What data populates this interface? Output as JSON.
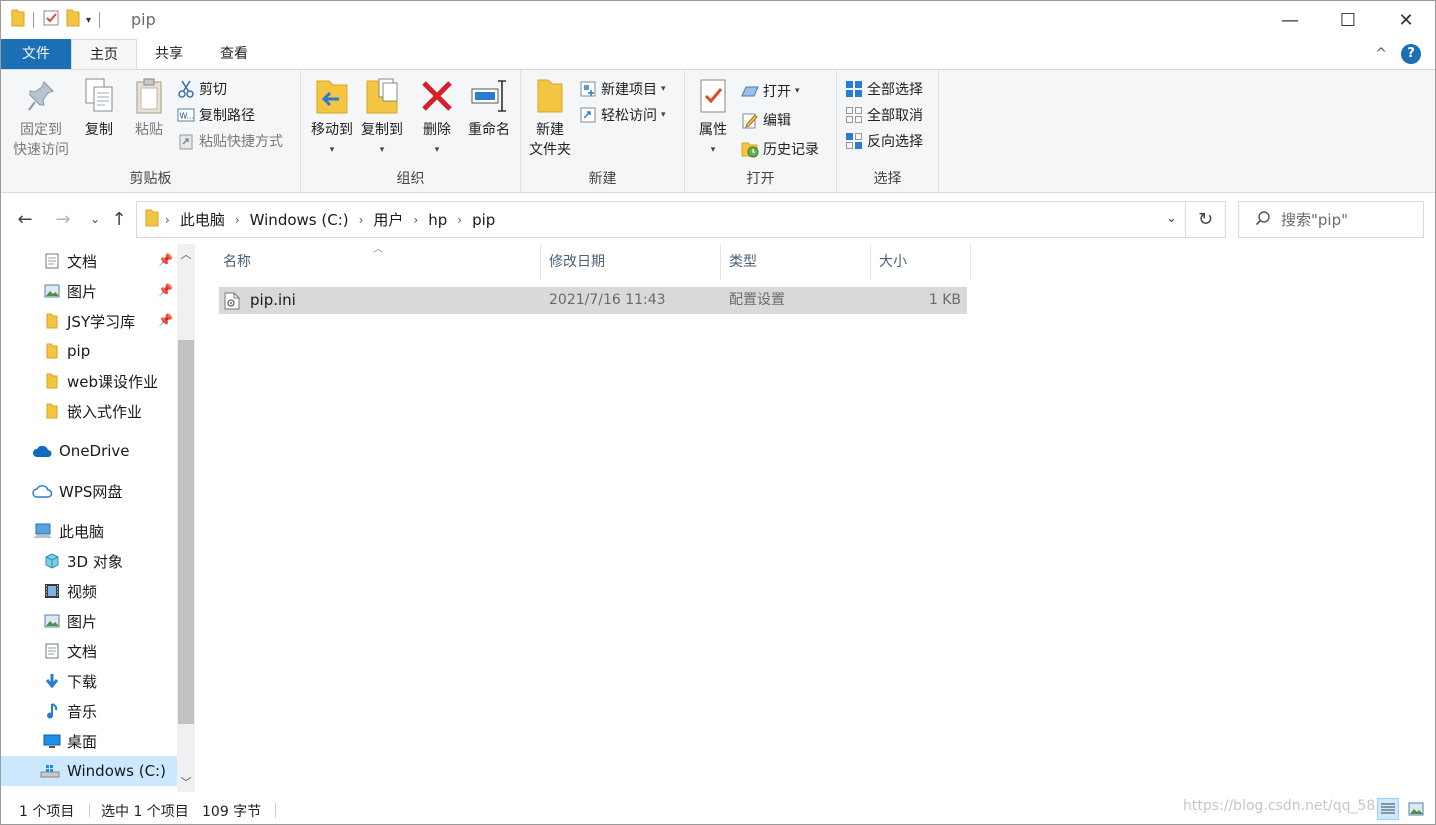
{
  "window": {
    "title": "pip",
    "minimize": "—",
    "maximize": "☐",
    "close": "✕"
  },
  "menu": {
    "tabs": [
      "文件",
      "主页",
      "共享",
      "查看"
    ],
    "collapse": "^",
    "help": "?"
  },
  "ribbon": {
    "clipboard": {
      "label": "剪贴板",
      "pin": [
        "固定到",
        "快速访问"
      ],
      "copy": "复制",
      "paste": "粘贴",
      "cut": "剪切",
      "copy_path": "复制路径",
      "paste_shortcut": "粘贴快捷方式"
    },
    "organize": {
      "label": "组织",
      "move_to": "移动到",
      "copy_to": "复制到",
      "delete": "删除",
      "rename": "重命名"
    },
    "new": {
      "label": "新建",
      "new_folder": [
        "新建",
        "文件夹"
      ],
      "new_item": "新建项目",
      "easy_access": "轻松访问"
    },
    "open": {
      "label": "打开",
      "properties": "属性",
      "open": "打开",
      "edit": "编辑",
      "history": "历史记录"
    },
    "select": {
      "label": "选择",
      "select_all": "全部选择",
      "select_none": "全部取消",
      "invert": "反向选择"
    }
  },
  "address": {
    "crumbs": [
      "此电脑",
      "Windows (C:)",
      "用户",
      "hp",
      "pip"
    ],
    "search_placeholder": "搜索\"pip\""
  },
  "nav": {
    "items": [
      {
        "label": "文档",
        "icon": "document-icon"
      },
      {
        "label": "图片",
        "icon": "picture-icon"
      },
      {
        "label": "JSY学习库",
        "icon": "folder-icon"
      },
      {
        "label": "pip",
        "icon": "folder-icon"
      },
      {
        "label": "web课设作业",
        "icon": "folder-icon"
      },
      {
        "label": "嵌入式作业",
        "icon": "folder-icon"
      },
      {
        "label": "OneDrive",
        "icon": "cloud-icon"
      },
      {
        "label": "WPS网盘",
        "icon": "cloud-outline-icon"
      },
      {
        "label": "此电脑",
        "icon": "computer-icon"
      },
      {
        "label": "3D 对象",
        "icon": "cube-icon"
      },
      {
        "label": "视频",
        "icon": "video-icon"
      },
      {
        "label": "图片",
        "icon": "picture-icon"
      },
      {
        "label": "文档",
        "icon": "document-icon"
      },
      {
        "label": "下载",
        "icon": "download-icon"
      },
      {
        "label": "音乐",
        "icon": "music-icon"
      },
      {
        "label": "桌面",
        "icon": "desktop-icon"
      },
      {
        "label": "Windows (C:)",
        "icon": "drive-icon"
      }
    ]
  },
  "files": {
    "columns": [
      "名称",
      "修改日期",
      "类型",
      "大小"
    ],
    "rows": [
      {
        "name": "pip.ini",
        "modified": "2021/7/16 11:43",
        "type": "配置设置",
        "size": "1 KB"
      }
    ]
  },
  "status": {
    "count": "1 个项目",
    "selected": "选中 1 个项目",
    "size": "109 字节",
    "watermark": "https://blog.csdn.net/qq_58..."
  },
  "colors": {
    "accent": "#1a6fb5",
    "selection": "#cce8ff",
    "row_selected": "#d9d9d9",
    "folder": "#f4c542"
  }
}
